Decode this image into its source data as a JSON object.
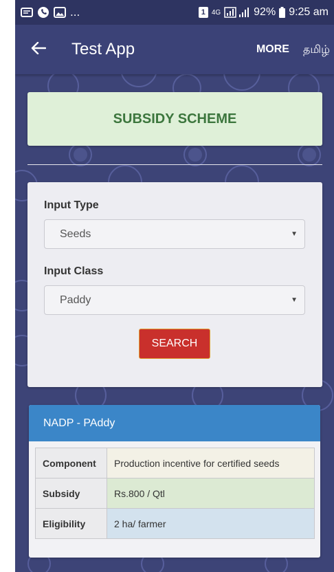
{
  "status_bar": {
    "left_ellipsis": "...",
    "sim_badge": "1",
    "network": "4G",
    "battery": "92%",
    "time": "9:25 am"
  },
  "app_bar": {
    "back_icon": "arrow-left-icon",
    "title": "Test App",
    "more_label": "MORE",
    "language_label": "தமிழ்"
  },
  "title_card": {
    "title": "SUBSIDY SCHEME"
  },
  "search_form": {
    "input_type_label": "Input Type",
    "input_type_value": "Seeds",
    "input_class_label": "Input Class",
    "input_class_value": "Paddy",
    "search_label": "SEARCH"
  },
  "result": {
    "header": "NADP - PAddy",
    "rows": [
      {
        "key": "Component",
        "value": "Production incentive for certified seeds"
      },
      {
        "key": "Subsidy",
        "value": "Rs.800 / Qtl"
      },
      {
        "key": "Eligibility",
        "value": "2 ha/ farmer"
      }
    ]
  },
  "colors": {
    "background": "#3d4477",
    "title_card_bg": "#dff0d8",
    "title_text": "#3c763d",
    "search_button": "#c9302c",
    "result_header": "#3b86c8"
  }
}
